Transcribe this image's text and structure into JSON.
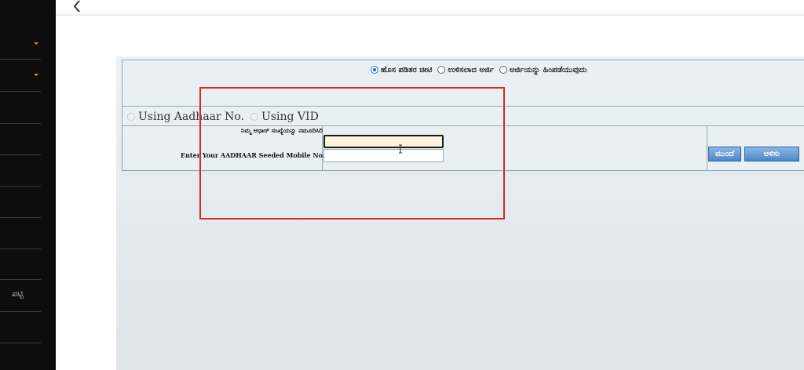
{
  "sidebar": {
    "partial_text": "ಪಟ್ಟಿ"
  },
  "nav": {
    "back_icon": "chevron-left-icon"
  },
  "form": {
    "application_options": [
      {
        "label": "ಹೊಸ ಪಡಿತರ ಚೀಟಿ",
        "selected": true
      },
      {
        "label": "ಉಳಿಸಲಾದ ಅರ್ಜಿ",
        "selected": false
      },
      {
        "label": "ಅರ್ಜಿಯನ್ನು ಹಿಂಪಡೆಯುವುದು",
        "selected": false
      }
    ],
    "id_options": [
      {
        "label": "Using Aadhaar No.",
        "selected": true,
        "disabled": true
      },
      {
        "label": "Using VID",
        "selected": false,
        "disabled": true
      }
    ],
    "mobile_label_kn": "ನಿಮ್ಮ ಆಧಾರ್ ಸಂಖ್ಯೆಯನ್ನು ನಮೂದಿಸಿರಿ",
    "mobile_label_en": "Enter Your AADHAAR Seeded Mobile No.",
    "aadhaar_value": "",
    "mobile_value": "",
    "next_button": "ಮುಂದೆ",
    "clear_button": "ಅಳಿಸು"
  },
  "colors": {
    "highlight_border": "#e0242c",
    "button_blue": "#4f86c9",
    "input_focus_bg": "#fdf2de"
  }
}
